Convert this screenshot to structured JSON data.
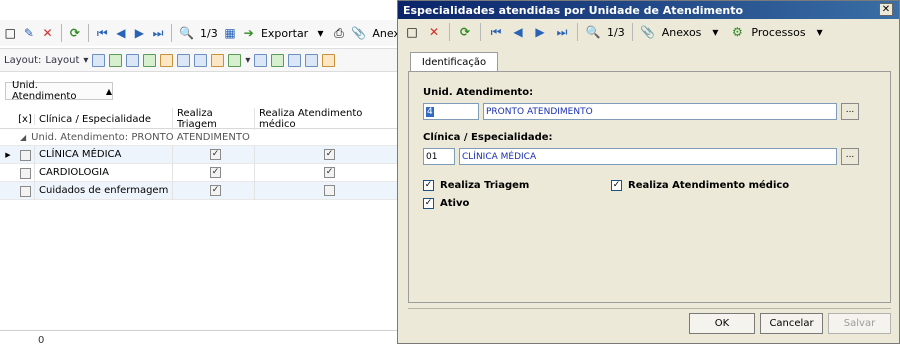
{
  "background": {
    "toolbar": {
      "page_indicator": "1/3",
      "export_label": "Exportar",
      "anexos_label": "Anex"
    },
    "layout_bar": {
      "layout_label": "Layout:",
      "layout_dropdown": "Layout"
    },
    "group_chip": "Unid. Atendimento",
    "grid": {
      "columns": [
        "[x]",
        "Clínica / Especialidade",
        "Realiza Triagem",
        "Realiza Atendimento médico"
      ],
      "group_row": "Unid. Atendimento: PRONTO ATENDIMENTO",
      "rows": [
        {
          "clinic": "CLÍNICA MÉDICA",
          "triagem": true,
          "atendimento": true,
          "selected": false
        },
        {
          "clinic": "CARDIOLOGIA",
          "triagem": true,
          "atendimento": true,
          "selected": false
        },
        {
          "clinic": "Cuidados de enfermagem",
          "triagem": true,
          "atendimento": false,
          "selected": false
        }
      ]
    },
    "footer_count": "0"
  },
  "dialog": {
    "title": "Especialidades atendidas por Unidade de Atendimento",
    "toolbar": {
      "page_indicator": "1/3",
      "anexos_label": "Anexos",
      "processos_label": "Processos"
    },
    "tab_label": "Identificação",
    "unid_label": "Unid. Atendimento:",
    "unid_code": "4",
    "unid_desc": "PRONTO ATENDIMENTO",
    "clinica_label": "Clínica / Especialidade:",
    "clinica_code": "01",
    "clinica_desc": "CLÍNICA MÉDICA",
    "checkboxes": {
      "triagem": {
        "label": "Realiza Triagem",
        "checked": true
      },
      "atendimento": {
        "label": "Realiza Atendimento médico",
        "checked": true
      },
      "ativo": {
        "label": "Ativo",
        "checked": true
      }
    },
    "buttons": {
      "ok": "OK",
      "cancel": "Cancelar",
      "save": "Salvar"
    }
  },
  "colors": {
    "title_bar_start": "#0a246a",
    "title_bar_end": "#3a6ea5",
    "dialog_bg": "#ece9d8",
    "selection": "#316ac5",
    "link_text": "#1a2fb0"
  }
}
